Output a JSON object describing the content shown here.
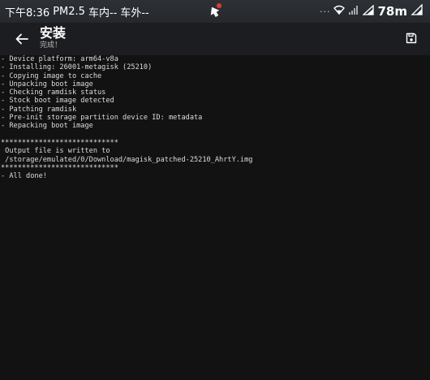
{
  "status_bar": {
    "time_label": "下午8:36",
    "pm_label": "PM2.5",
    "indoor_label": "车内--",
    "outdoor_label": "车外--",
    "dots": "···",
    "battery_level": "78m"
  },
  "app_bar": {
    "title": "安装",
    "subtitle": "完成！"
  },
  "console": {
    "lines": [
      "- Device platform: arm64-v8a",
      "- Installing: 26001-metagisk (25210)",
      "- Copying image to cache",
      "- Unpacking boot image",
      "- Checking ramdisk status",
      "- Stock boot image detected",
      "- Patching ramdisk",
      "- Pre-init storage partition device ID: metadata",
      "- Repacking boot image",
      "",
      "****************************",
      " Output file is written to",
      " /storage/emulated/0/Download/magisk_patched-25210_AhrtY.img",
      "****************************",
      "- All done!"
    ]
  },
  "colors": {
    "background": "#121212",
    "app_bar": "#1b1d20",
    "status_bar": "#2d3136",
    "text": "#dcdcdc"
  }
}
